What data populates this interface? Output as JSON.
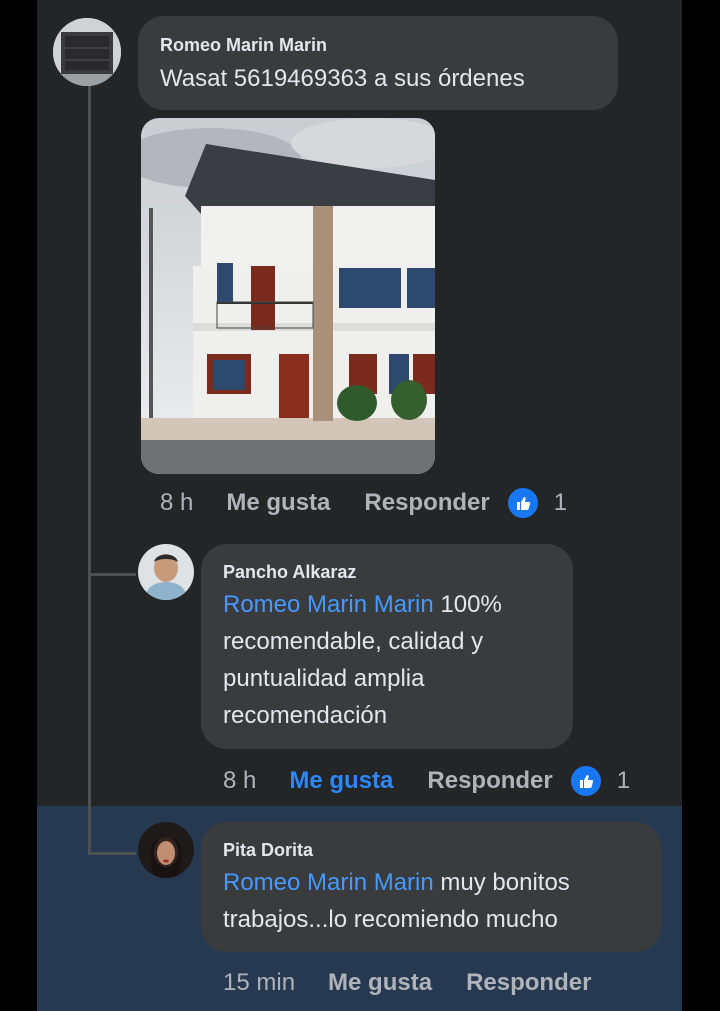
{
  "comments": [
    {
      "author": "Romeo Marin Marin",
      "text": "Wasat 5619469363 a sus órdenes",
      "time": "8 h",
      "like_label": "Me gusta",
      "reply_label": "Responder",
      "reaction_count": "1",
      "liked": false
    },
    {
      "author": "Pancho Alkaraz",
      "mention": "Romeo Marin Marin",
      "text_lines": [
        " 100%",
        "recomendable, calidad y",
        "puntualidad amplia",
        "recomendación"
      ],
      "time": "8 h",
      "like_label": "Me gusta",
      "reply_label": "Responder",
      "reaction_count": "1",
      "liked": true
    },
    {
      "author": "Pita Dorita",
      "mention": "Romeo Marin Marin",
      "text_lines": [
        " muy bonitos",
        "trabajos...lo recomiendo mucho"
      ],
      "time": "15 min",
      "like_label": "Me gusta",
      "reply_label": "Responder",
      "liked": false
    }
  ],
  "colors": {
    "background": "#242526",
    "bubble": "#3a3b3c",
    "highlight": "#263951",
    "mention": "#4599ff",
    "like_blue": "#1877f2"
  },
  "icons": [
    "like-reaction-icon"
  ]
}
